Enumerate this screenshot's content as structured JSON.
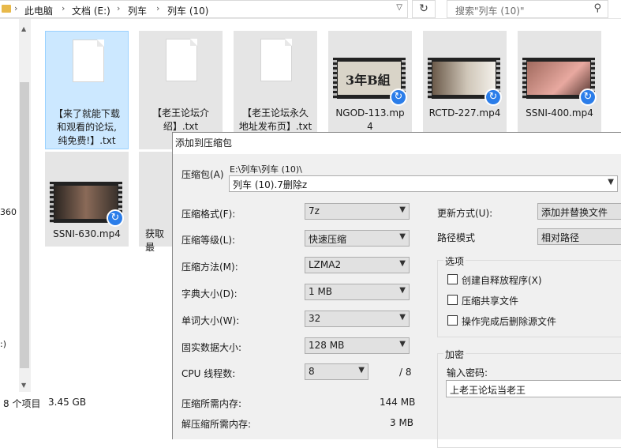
{
  "explorer": {
    "breadcrumb": [
      "此电脑",
      "文档 (E:)",
      "列车",
      "列车 (10)"
    ],
    "search_placeholder": "搜索\"列车 (10)\"",
    "nav_fragments": [
      "360",
      ":)"
    ],
    "status": {
      "count": "8 个项目",
      "size": "3.45 GB"
    },
    "files": [
      {
        "name": "【来了就能下载和观看的论坛,纯免费!】.txt",
        "lines": [
          "【来了就能下载",
          "和观看的论坛,",
          "纯免费!】.txt"
        ],
        "kind": "txt",
        "selected": true
      },
      {
        "name": "【老王论坛介绍】.txt",
        "lines": [
          "【老王论坛介",
          "绍】.txt"
        ],
        "kind": "txt"
      },
      {
        "name": "【老王论坛永久地址发布页】.txt",
        "lines": [
          "【老王论坛永久",
          "地址发布页】.txt"
        ],
        "kind": "txt"
      },
      {
        "name": "NGOD-113.mp4",
        "lines": [
          "NGOD-113.mp",
          "4"
        ],
        "kind": "video",
        "frame_text": "3年B組"
      },
      {
        "name": "RCTD-227.mp4",
        "lines": [
          "RCTD-227.mp4"
        ],
        "kind": "video"
      },
      {
        "name": "SSNI-400.mp4",
        "lines": [
          "SSNI-400.mp4"
        ],
        "kind": "video"
      },
      {
        "name": "SSNI-630.mp4",
        "lines": [
          "SSNI-630.mp4"
        ],
        "kind": "video"
      },
      {
        "name": "获取最",
        "lines": [
          "获取最"
        ],
        "kind": "txt"
      }
    ]
  },
  "dialog": {
    "title": "添加到压缩包",
    "archive_label": "压缩包(A)",
    "archive_path": "E:\\列车\\列车 (10)\\",
    "archive_name": "列车 (10).7删除z",
    "format_label": "压缩格式(F):",
    "format_value": "7z",
    "level_label": "压缩等级(L):",
    "level_value": "快速压缩",
    "method_label": "压缩方法(M):",
    "method_value": "LZMA2",
    "dict_label": "字典大小(D):",
    "dict_value": "1 MB",
    "word_label": "单词大小(W):",
    "word_value": "32",
    "solid_label": "固实数据大小:",
    "solid_value": "128 MB",
    "cpu_label": "CPU 线程数:",
    "cpu_value": "8",
    "cpu_total": "/ 8",
    "mem_comp_label": "压缩所需内存:",
    "mem_comp_value": "144 MB",
    "mem_decomp_label": "解压缩所需内存:",
    "mem_decomp_value": "3 MB",
    "update_label": "更新方式(U):",
    "update_value": "添加并替换文件",
    "path_label": "路径模式",
    "path_value": "相对路径",
    "options_title": "选项",
    "opt_sfx": "创建自释放程序(X)",
    "opt_shared": "压缩共享文件",
    "opt_delete": "操作完成后删除源文件",
    "encrypt_title": "加密",
    "password_label": "输入密码:",
    "password_value": "上老王论坛当老王"
  }
}
